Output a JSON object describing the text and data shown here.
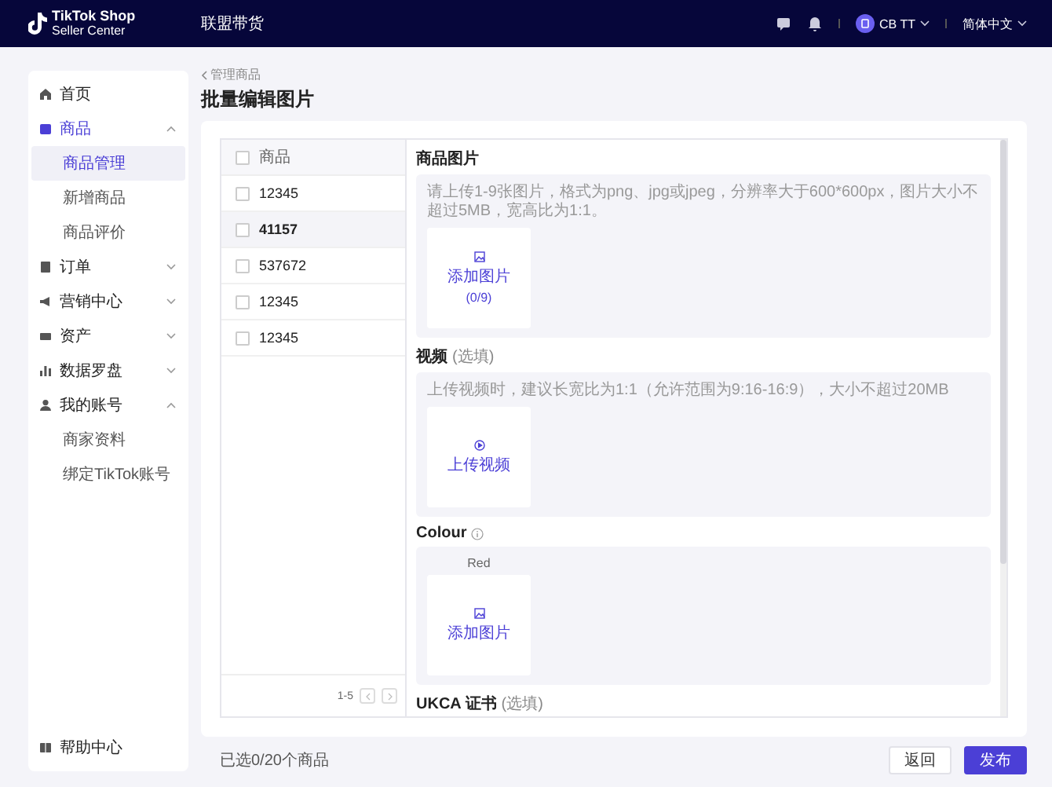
{
  "top_bar": {
    "logo_line1": "TikTok Shop",
    "logo_line2": "Seller Center",
    "title": "联盟带货",
    "user": "CB TT",
    "language": "简体中文"
  },
  "sidebar": {
    "items": [
      {
        "label": "首页",
        "selected": false
      },
      {
        "label": "商品",
        "selected": true,
        "expanded": true,
        "children": [
          {
            "label": "商品管理",
            "selected": true
          },
          {
            "label": "新增商品",
            "selected": false
          },
          {
            "label": "商品评价",
            "selected": false
          }
        ]
      },
      {
        "label": "订单",
        "selected": false,
        "expanded": false
      },
      {
        "label": "营销中心",
        "selected": false,
        "expanded": false
      },
      {
        "label": "资产",
        "selected": false,
        "expanded": false
      },
      {
        "label": "数据罗盘",
        "selected": false,
        "expanded": false
      },
      {
        "label": "我的账号",
        "selected": false,
        "expanded": true,
        "children": [
          {
            "label": "商家资料",
            "selected": false
          },
          {
            "label": "绑定TikTok账号",
            "selected": false
          }
        ]
      }
    ],
    "footer": "帮助中心"
  },
  "page": {
    "breadcrumb": "管理商品",
    "title": "批量编辑图片"
  },
  "product_table": {
    "header": "商品",
    "header_checked": false,
    "rows": [
      {
        "id": "12345",
        "checked": false,
        "selected": false
      },
      {
        "id": "41157",
        "checked": false,
        "selected": true
      },
      {
        "id": "537672",
        "checked": false,
        "selected": false
      },
      {
        "id": "12345",
        "checked": false,
        "selected": false
      },
      {
        "id": "12345",
        "checked": false,
        "selected": false
      }
    ],
    "pagination": "1-5"
  },
  "sections": [
    {
      "kind": "images",
      "title": "商品图片",
      "hint": "请上传1-9张图片，格式为png、jpg或jpeg，分辨率大于600*600px，图片大小不超过5MB，宽高比为1:1。",
      "tile_label": "添加图片",
      "tile_count": "(0/9)"
    },
    {
      "kind": "video",
      "title": "视频",
      "optional": "(选填)",
      "hint": "上传视频时，建议长宽比为1:1（允许范围为9:16-16:9），大小不超过20MB",
      "tile_label": "上传视频"
    },
    {
      "kind": "variant",
      "title": "Colour",
      "info": true,
      "variant": "Red",
      "tile_label": "添加图片"
    },
    {
      "kind": "heading",
      "title": "UKCA 证书",
      "optional": "(选填)"
    }
  ],
  "footer": {
    "selection": "已选0/20个商品",
    "buttons": [
      {
        "label": "返回",
        "kind": "secondary"
      },
      {
        "label": "发布",
        "kind": "primary"
      }
    ]
  }
}
